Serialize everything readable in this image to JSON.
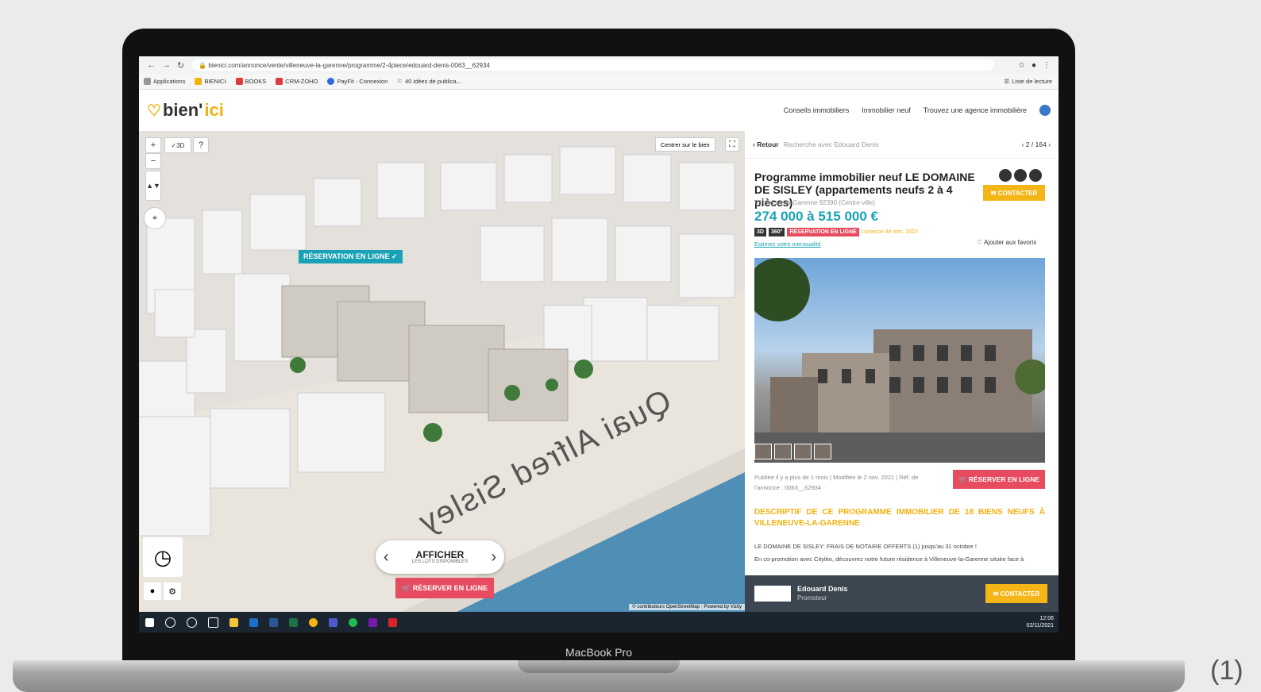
{
  "browser": {
    "url": "bienici.com/annonce/vente/villeneuve-la-garenne/programme/2-4piece/edouard-denis-0063__62934",
    "bookmarks": [
      "Applications",
      "BIENICI",
      "BOOKS",
      "CRM-ZOHO",
      "PayFit - Connexion",
      "40 idées de publica..."
    ],
    "reading_list": "Liste de lecture"
  },
  "site": {
    "logo_prefix": "bien'",
    "logo_suffix": "ici",
    "nav": [
      "Conseils immobiliers",
      "Immobilier neuf",
      "Trouvez une agence immobilière"
    ]
  },
  "map": {
    "mode_3d": "3D",
    "help": "?",
    "center_button": "Centrer sur le bien",
    "reservation_tag": "RÉSERVATION EN LIGNE ✓",
    "street_label": "Quai Alfred Sisley",
    "show_label": "AFFICHER",
    "show_sub": "LES LOTS DISPONIBLES",
    "reserve_label": "RÉSERVER EN LIGNE",
    "attribution": "© contributeurs OpenStreetMap · Powered by Vizity"
  },
  "panel": {
    "back_label": "Retour",
    "search_label": "Recherche avec Edouard Denis",
    "pager": "2 / 164",
    "title": "Programme immobilier neuf LE DOMAINE DE SISLEY (appartements neufs 2 à 4 pièces)",
    "location": "Villeneuve-la-Garenne 92390 (Centre-ville)",
    "price": "274 000 à 515 000 €",
    "tag_3d": "3D",
    "tag_360": "360°",
    "tag_reservation": "RÉSERVATION EN LIGNE",
    "delivery": "Livraison 4e trim. 2023",
    "estimate_link": "Estimez votre mensualité",
    "favorite": "Ajouter aux favoris",
    "contact_label": "CONTACTER",
    "published": "Publiée il y a plus de 1 mois | Modifiée le 2 nov. 2021 | Réf. de l'annonce : 0063__62934",
    "reserve_label": "RÉSERVER EN LIGNE",
    "desc_title": "DESCRIPTIF DE CE PROGRAMME IMMOBILIER DE 18 BIENS NEUFS À VILLENEUVE-LA-GARENNE",
    "desc_line1": "LE DOMAINE DE SISLEY: FRAIS DE NOTAIRE OFFERTS (1) jusqu'au 31 octobre !",
    "desc_line2": "En co-promotion avec Cityléo, découvrez notre future résidence à Villeneuve-la-Garenne située face à",
    "promoter_name": "Edouard Denis",
    "promoter_role": "Promoteur",
    "promoter_contact": "CONTACTER"
  },
  "taskbar": {
    "time": "12:06",
    "date": "02/11/2021"
  },
  "device": {
    "brand": "MacBook Pro",
    "caption": "(1)"
  },
  "colors": {
    "accent_teal": "#19a2b5",
    "accent_yellow": "#f4b617",
    "accent_red": "#e64b5f"
  }
}
